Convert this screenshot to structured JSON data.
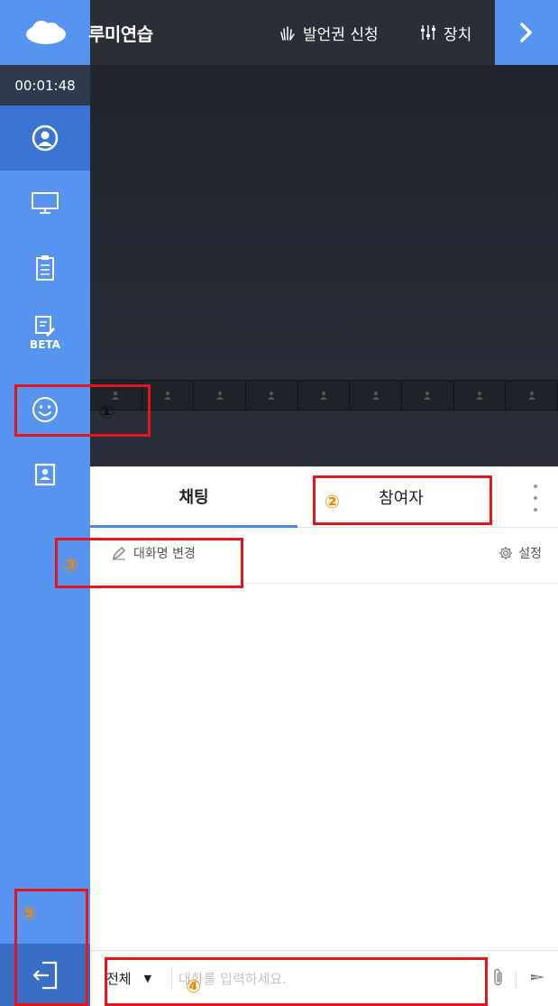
{
  "topbar": {
    "room_title": "루미연습",
    "speak_request_label": "발언권 신청",
    "device_label": "장치"
  },
  "sidebar": {
    "timer": "00:01:48",
    "items": [
      {
        "icon": "user-circle-icon",
        "active": true
      },
      {
        "icon": "monitor-icon"
      },
      {
        "icon": "clipboard-icon"
      },
      {
        "icon": "note-edit-icon",
        "badge": "BETA"
      },
      {
        "icon": "smiley-icon"
      },
      {
        "icon": "contact-card-icon"
      }
    ],
    "exit_icon": "exit-door-icon"
  },
  "video": {
    "thumbnail_count": 9
  },
  "chat": {
    "tabs": [
      {
        "label": "채팅",
        "active": true
      },
      {
        "label": "참여자",
        "active": false
      }
    ],
    "rename_label": "대화명 변경",
    "settings_label": "설정",
    "target_value": "전체",
    "input_placeholder": "대화를 입력하세요."
  },
  "annotations": [
    {
      "number": "①"
    },
    {
      "number": "②"
    },
    {
      "number": "③"
    },
    {
      "number": "④"
    },
    {
      "number": "⑤"
    }
  ],
  "colors": {
    "sidebar": "#5794f0",
    "sidebar_active": "#3a73d4",
    "topbar": "#2b2e36",
    "tab_underline": "#4a86e8",
    "annotation_red": "#e8141b",
    "annotation_orange": "#f08a00"
  }
}
